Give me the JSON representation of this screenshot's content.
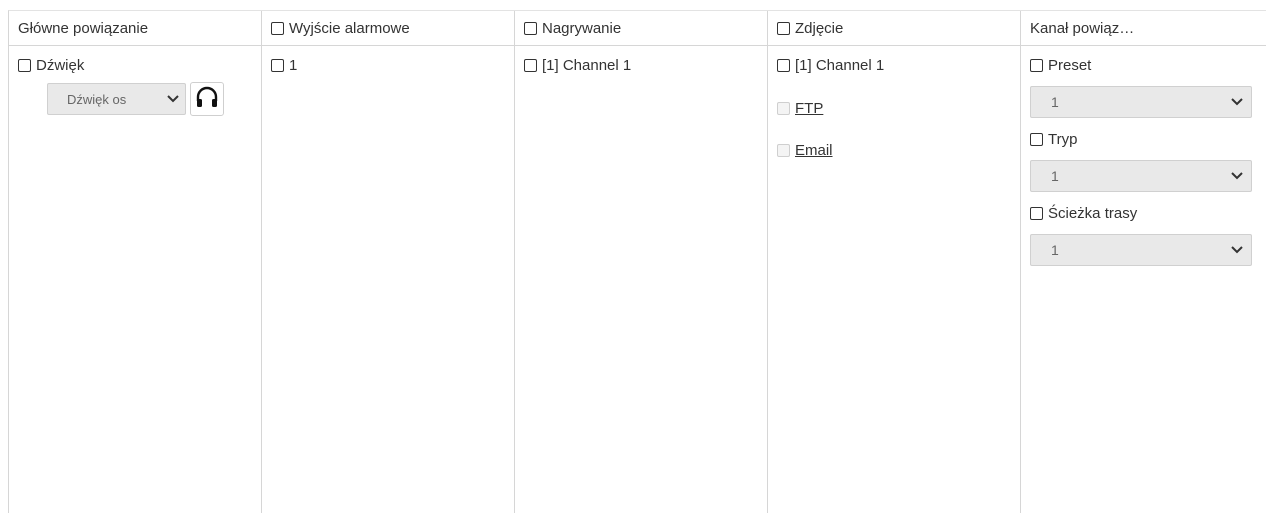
{
  "columns": {
    "main": {
      "header": "Główne powiązanie",
      "sound_label": "Dźwięk",
      "sound_select": "Dźwięk os",
      "headphones_icon": "headphones-icon"
    },
    "alarm": {
      "header": "Wyjście alarmowe",
      "item": "1"
    },
    "record": {
      "header": "Nagrywanie",
      "item": "[1] Channel 1"
    },
    "photo": {
      "header": "Zdjęcie",
      "item": "[1] Channel 1",
      "ftp": "FTP",
      "email": "Email"
    },
    "channel": {
      "header": "Kanał powiąz…",
      "preset_label": "Preset",
      "preset_value": "1",
      "tryp_label": "Tryp",
      "tryp_value": "1",
      "route_label": "Ścieżka trasy",
      "route_value": "1"
    }
  },
  "colors": {
    "border": "#d6d6d6",
    "select_bg": "#e9e9e9",
    "text": "#333333"
  }
}
